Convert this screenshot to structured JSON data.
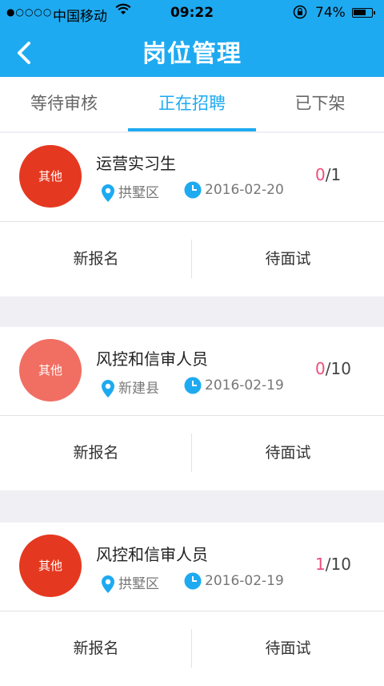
{
  "status_bar": {
    "signal": "●○○○○",
    "carrier": "中国移动",
    "time": "09:22",
    "battery": "74%",
    "battery_level": 0.74
  },
  "header": {
    "title": "岗位管理",
    "back_icon": "chevron-left-icon",
    "color": "#1eaaf1"
  },
  "tabs": [
    {
      "label": "等待审核",
      "active": false
    },
    {
      "label": "正在招聘",
      "active": true
    },
    {
      "label": "已下架",
      "active": false
    }
  ],
  "jobs": [
    {
      "tag": "其他",
      "tag_color": "#e53820",
      "title": "运营实习生",
      "location": "拱墅区",
      "date": "2016-02-20",
      "applied": "0",
      "total": "1",
      "action_new": "新报名",
      "action_interview": "待面试"
    },
    {
      "tag": "其他",
      "tag_color": "#f16e62",
      "title": "风控和信审人员",
      "location": "新建县",
      "date": "2016-02-19",
      "applied": "0",
      "total": "10",
      "action_new": "新报名",
      "action_interview": "待面试"
    },
    {
      "tag": "其他",
      "tag_color": "#e53820",
      "title": "风控和信审人员",
      "location": "拱墅区",
      "date": "2016-02-19",
      "applied": "1",
      "total": "10",
      "action_new": "新报名",
      "action_interview": "待面试"
    }
  ],
  "colors": {
    "accent": "#1eaaf1",
    "count_highlight": "#ef4d7c",
    "background": "#efeff4"
  }
}
